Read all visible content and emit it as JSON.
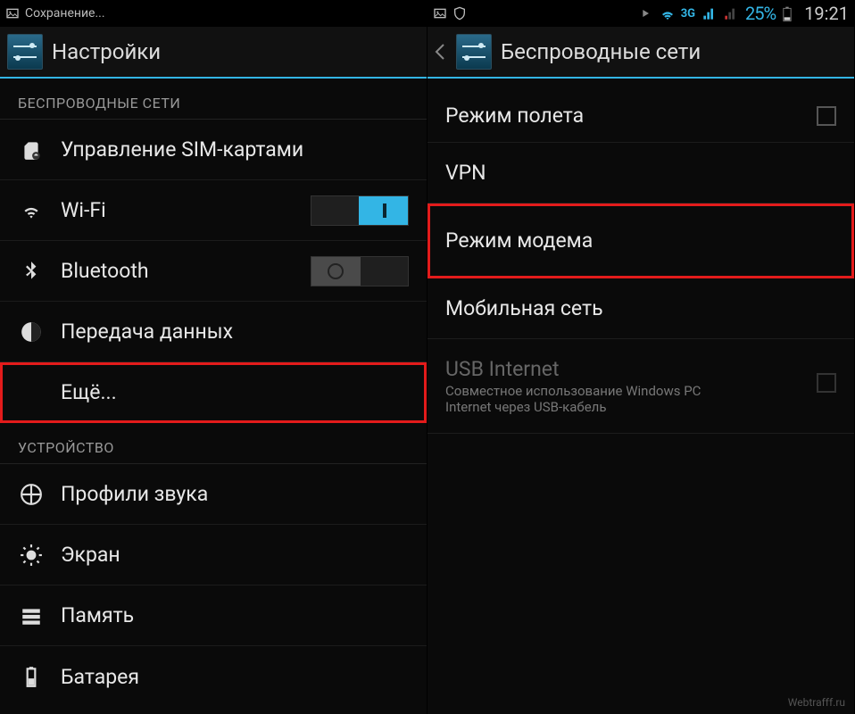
{
  "statusbar": {
    "left_text": "Сохранение...",
    "network_label": "3G",
    "battery_percent": "25%",
    "time": "19:21"
  },
  "left_panel": {
    "title": "Настройки",
    "section_wireless": "БЕСПРОВОДНЫЕ СЕТИ",
    "item_sim": "Управление SIM-картами",
    "item_wifi": "Wi-Fi",
    "item_bluetooth": "Bluetooth",
    "item_data": "Передача данных",
    "item_more": "Ещё...",
    "section_device": "УСТРОЙСТВО",
    "item_audio": "Профили звука",
    "item_display": "Экран",
    "item_memory": "Память",
    "item_battery": "Батарея"
  },
  "right_panel": {
    "title": "Беспроводные сети",
    "item_airplane": "Режим полета",
    "item_vpn": "VPN",
    "item_tether": "Режим модема",
    "item_mobile": "Мобильная сеть",
    "item_usb": "USB Internet",
    "item_usb_sub": "Совместное использование Windows PC Internet через USB-кабель"
  },
  "watermark": "Webtrafff.ru"
}
